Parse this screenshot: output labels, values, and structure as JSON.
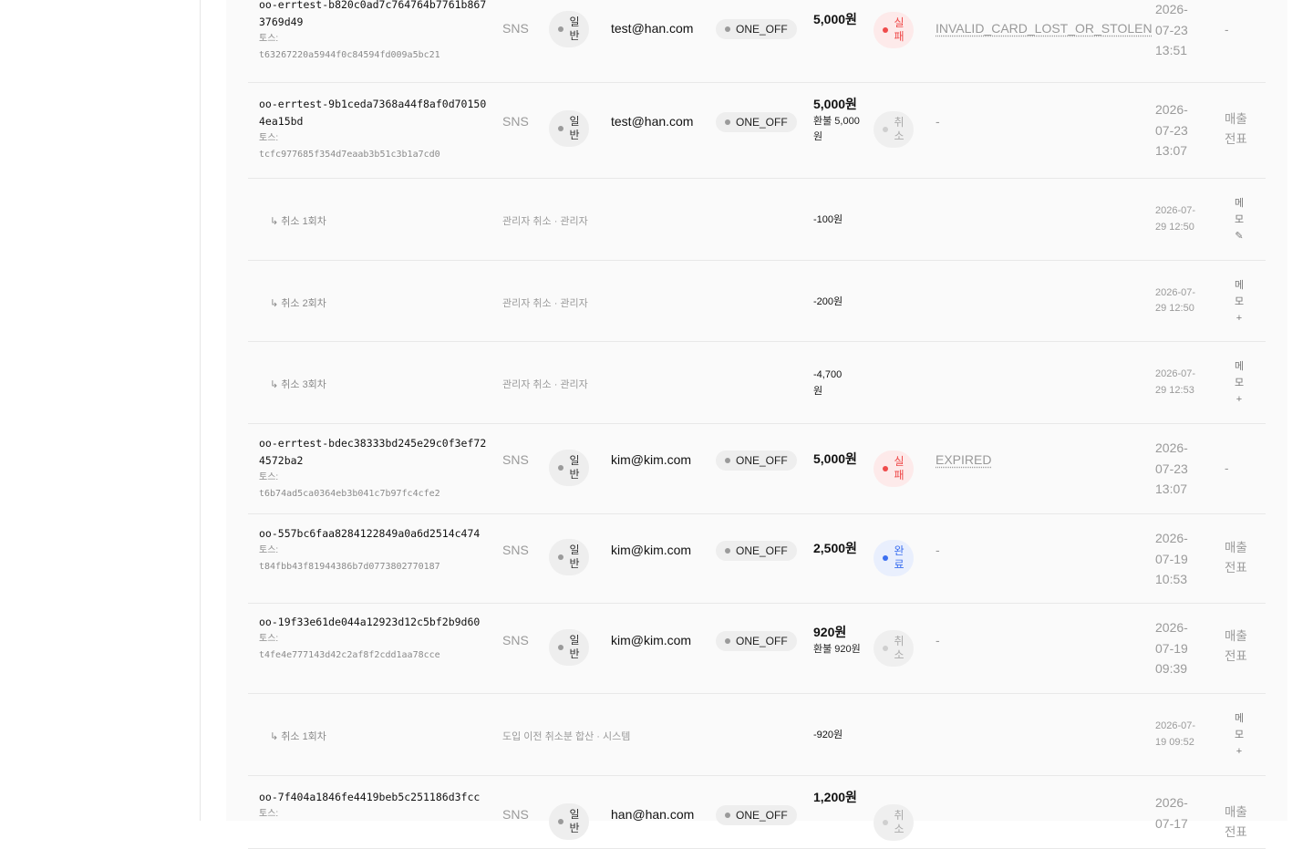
{
  "rows": [
    {
      "kind": "main",
      "order_id": "oo-errtest-b820c0ad7c764764b7761b8673769d49",
      "toss_label": "토스:",
      "toss_id": "t63267220a5944f0c84594fd009a5bc21",
      "channel": "SNS",
      "type": "일반",
      "email": "test@han.com",
      "mode": "ONE_OFF",
      "amount": "5,000원",
      "refund": "",
      "status": "실패",
      "status_kind": "fail",
      "reason": "INVALID_CARD_LOST_OR_STOLEN",
      "reason_link": true,
      "date": "2026-07-23 13:51",
      "action": "-"
    },
    {
      "kind": "main",
      "order_id": "oo-errtest-9b1ceda7368a44f8af0d701504ea15bd",
      "toss_label": "토스:",
      "toss_id": "tcfc977685f354d7eaab3b51c3b1a7cd0",
      "channel": "SNS",
      "type": "일반",
      "email": "test@han.com",
      "mode": "ONE_OFF",
      "amount": "5,000원",
      "refund": "환불 5,000원",
      "status": "취소",
      "status_kind": "cancel",
      "reason": "-",
      "reason_link": false,
      "date": "2026-07-23 13:07",
      "action": "매출전표"
    },
    {
      "kind": "sub",
      "label": "↳ 취소 1회차",
      "who": "관리자 취소 · 관리자",
      "amount": "-100원",
      "date": "2026-07-29 12:50",
      "memo": "메모✎"
    },
    {
      "kind": "sub",
      "label": "↳ 취소 2회차",
      "who": "관리자 취소 · 관리자",
      "amount": "-200원",
      "date": "2026-07-29 12:50",
      "memo": "메모+"
    },
    {
      "kind": "sub",
      "label": "↳ 취소 3회차",
      "who": "관리자 취소 · 관리자",
      "amount": "-4,700원",
      "date": "2026-07-29 12:53",
      "memo": "메모+"
    },
    {
      "kind": "main",
      "order_id": "oo-errtest-bdec38333bd245e29c0f3ef724572ba2",
      "toss_label": "토스:",
      "toss_id": "t6b74ad5ca0364eb3b041c7b97fc4cfe2",
      "channel": "SNS",
      "type": "일반",
      "email": "kim@kim.com",
      "mode": "ONE_OFF",
      "amount": "5,000원",
      "refund": "",
      "status": "실패",
      "status_kind": "fail",
      "reason": "EXPIRED",
      "reason_link": true,
      "date": "2026-07-23 13:07",
      "action": "-"
    },
    {
      "kind": "main",
      "order_id": "oo-557bc6faa8284122849a0a6d2514c474",
      "toss_label": "토스:",
      "toss_id": "t84fbb43f81944386b7d0773802770187",
      "channel": "SNS",
      "type": "일반",
      "email": "kim@kim.com",
      "mode": "ONE_OFF",
      "amount": "2,500원",
      "refund": "",
      "status": "완료",
      "status_kind": "done",
      "reason": "-",
      "reason_link": false,
      "date": "2026-07-19 10:53",
      "action": "매출전표"
    },
    {
      "kind": "main",
      "order_id": "oo-19f33e61de044a12923d12c5bf2b9d60",
      "toss_label": "토스:",
      "toss_id": "t4fe4e777143d42c2af8f2cdd1aa78cce",
      "channel": "SNS",
      "type": "일반",
      "email": "kim@kim.com",
      "mode": "ONE_OFF",
      "amount": "920원",
      "refund": "환불 920원",
      "status": "취소",
      "status_kind": "cancel",
      "reason": "-",
      "reason_link": false,
      "date": "2026-07-19 09:39",
      "action": "매출전표"
    },
    {
      "kind": "sub",
      "label": "↳ 취소 1회차",
      "who": "도입 이전 취소분 합산 · 시스템",
      "amount": "-920원",
      "date": "2026-07-19 09:52",
      "memo": "메모+"
    },
    {
      "kind": "main",
      "order_id": "oo-7f404a1846fe4419beb5c251186d3fcc",
      "toss_label": "토스:",
      "toss_id": "",
      "channel": "SNS",
      "type": "일반",
      "email": "han@han.com",
      "mode": "ONE_OFF",
      "amount": "1,200원",
      "refund": "",
      "status": "취소",
      "status_kind": "cancel",
      "reason": "",
      "reason_link": false,
      "date": "2026-07-17",
      "action": "매출전표"
    }
  ],
  "colors": {
    "fail": "#ef4b4b",
    "done": "#3b6ff0",
    "cancel": "#aaaaaa",
    "panel": "#fafafa"
  }
}
